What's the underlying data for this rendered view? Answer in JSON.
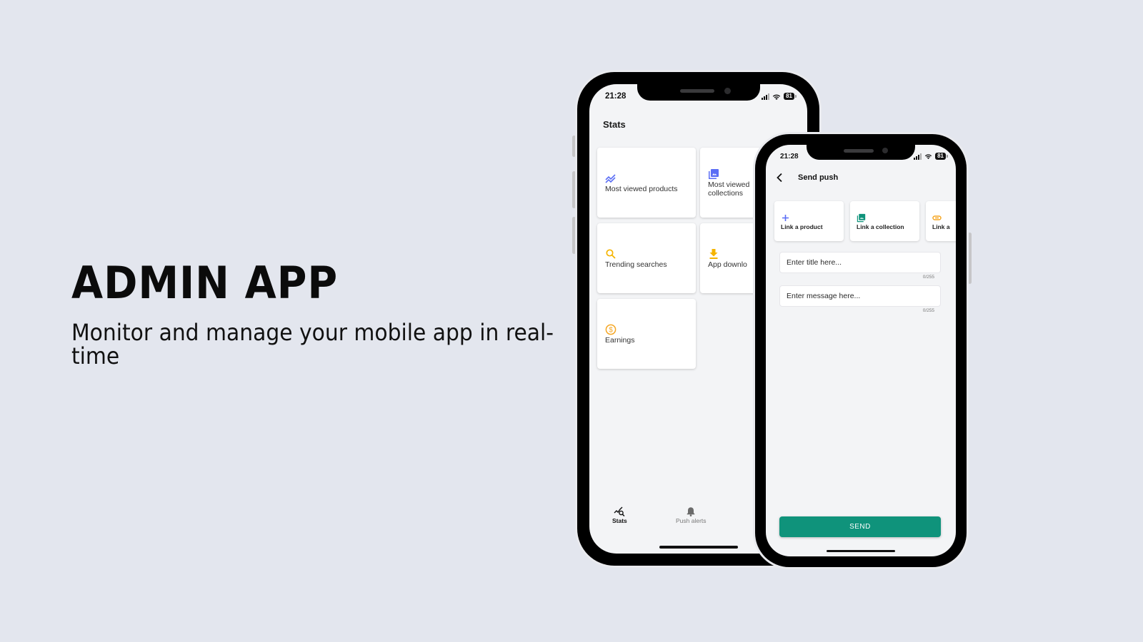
{
  "hero": {
    "title": "ADMIN APP",
    "subtitle": "Monitor and manage your mobile app in real-time"
  },
  "colors": {
    "background": "#e3e6ee",
    "accent_blue": "#5b6ef5",
    "accent_yellow": "#f5b400",
    "accent_orange": "#f5a623",
    "accent_teal": "#0f937b"
  },
  "stats_screen": {
    "status_time": "21:28",
    "battery": "81",
    "title": "Stats",
    "cards": [
      {
        "label": "Most viewed products",
        "icon": "trending-chart-icon"
      },
      {
        "label": "Most viewed collections",
        "icon": "image-collection-icon"
      },
      {
        "label": "Trending searches",
        "icon": "search-icon"
      },
      {
        "label": "App downlo",
        "icon": "download-icon"
      },
      {
        "label": "Earnings",
        "icon": "dollar-coin-icon"
      }
    ],
    "tabs": [
      {
        "label": "Stats",
        "icon": "stats-chart-icon",
        "active": true
      },
      {
        "label": "Push alerts",
        "icon": "bell-icon",
        "active": false
      }
    ]
  },
  "push_screen": {
    "status_time": "21:28",
    "battery": "81",
    "title": "Send push",
    "link_options": [
      {
        "label": "Link a product",
        "icon": "plus-icon"
      },
      {
        "label": "Link a collection",
        "icon": "image-collection-icon"
      },
      {
        "label": "Link a",
        "icon": "link-icon"
      }
    ],
    "title_field": {
      "placeholder": "Enter title here...",
      "value": "",
      "counter": "0/255"
    },
    "message_field": {
      "placeholder": "Enter message here...",
      "value": "",
      "counter": "0/255"
    },
    "send_label": "SEND"
  }
}
